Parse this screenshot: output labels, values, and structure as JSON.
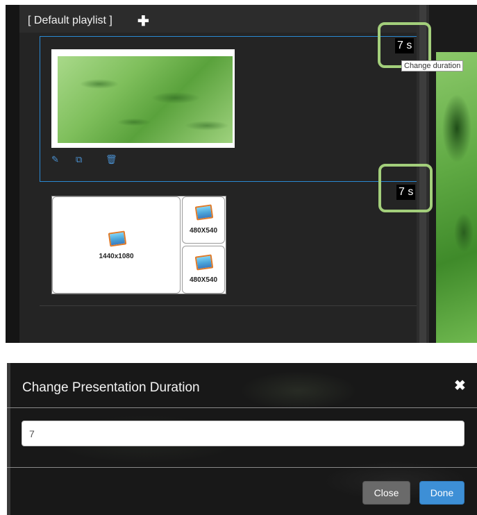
{
  "playlist": {
    "title": "[ Default playlist ]",
    "add_icon": "plus-icon"
  },
  "slides": [
    {
      "duration": "7 s",
      "tooltip": "Change duration",
      "tools": [
        "edit-icon",
        "duplicate-icon",
        "trash-icon"
      ]
    },
    {
      "duration": "7 s",
      "zones": [
        {
          "label": "1440x1080",
          "icon": "image-icon"
        },
        {
          "label": "480X540",
          "icon": "image-icon"
        },
        {
          "label": "480X540",
          "icon": "image-icon"
        }
      ]
    }
  ],
  "modal": {
    "title": "Change Presentation Duration",
    "close_icon": "close-icon",
    "input_value": "7",
    "buttons": {
      "close": "Close",
      "done": "Done"
    }
  },
  "colors": {
    "selection_border": "#2a8ad4",
    "highlight": "#a3cf7b",
    "done_button": "#3d8fd6",
    "close_button": "#6a6a6a"
  }
}
